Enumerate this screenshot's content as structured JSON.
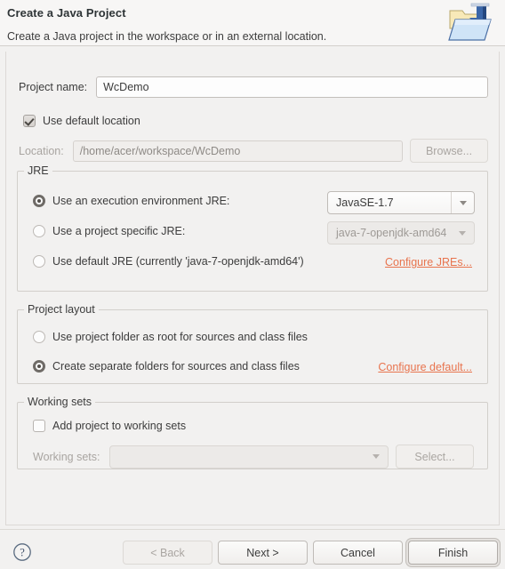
{
  "header": {
    "title": "Create a Java Project",
    "description": "Create a Java project in the workspace or in an external location.",
    "icon": "java-project-folder-icon"
  },
  "project_name": {
    "label": "Project name:",
    "value": "WcDemo"
  },
  "use_default_location": {
    "label": "Use default location",
    "checked": true
  },
  "location": {
    "label": "Location:",
    "value": "/home/acer/workspace/WcDemo",
    "browse_label": "Browse...",
    "enabled": false
  },
  "jre": {
    "group_title": "JRE",
    "options": [
      {
        "label": "Use an execution environment JRE:",
        "selected": true,
        "combo_value": "JavaSE-1.7",
        "combo_enabled": true
      },
      {
        "label": "Use a project specific JRE:",
        "selected": false,
        "combo_value": "java-7-openjdk-amd64",
        "combo_enabled": false
      },
      {
        "label": "Use default JRE (currently 'java-7-openjdk-amd64')",
        "selected": false
      }
    ],
    "configure_link": "Configure JREs..."
  },
  "project_layout": {
    "group_title": "Project layout",
    "options": [
      {
        "label": "Use project folder as root for sources and class files",
        "selected": false
      },
      {
        "label": "Create separate folders for sources and class files",
        "selected": true
      }
    ],
    "configure_link": "Configure default..."
  },
  "working_sets": {
    "group_title": "Working sets",
    "add_checkbox": {
      "label": "Add project to working sets",
      "checked": false
    },
    "combo_label": "Working sets:",
    "combo_value": "",
    "select_label": "Select...",
    "enabled": false
  },
  "footer": {
    "help_icon": "help-question-icon",
    "buttons": [
      {
        "label": "< Back",
        "enabled": false,
        "focused": false
      },
      {
        "label": "Next >",
        "enabled": true,
        "focused": false
      },
      {
        "label": "Cancel",
        "enabled": true,
        "focused": false
      },
      {
        "label": "Finish",
        "enabled": true,
        "focused": true
      }
    ]
  },
  "colors": {
    "background": "#f2f1f0",
    "header_bg": "#f7f6f5",
    "link": "#e8744e",
    "text": "#3c3c3c",
    "disabled_text": "#a9a5a1",
    "border": "#d2cfcb"
  }
}
